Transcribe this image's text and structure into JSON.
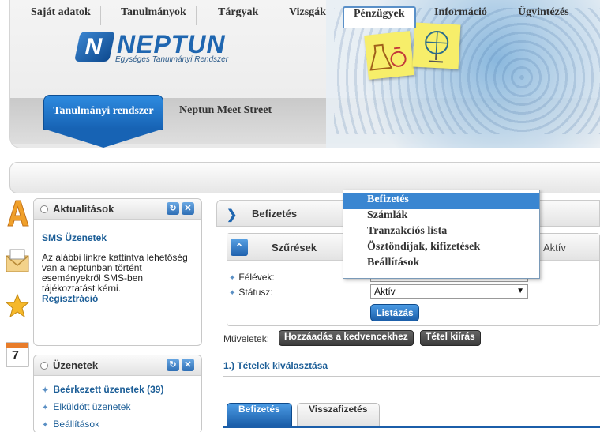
{
  "app": {
    "logo_title": "NEPTUN",
    "logo_subtitle": "Egységes Tanulmányi Rendszer",
    "system_tab": "Tanulmányi rendszer",
    "meet_street": "Neptun Meet Street"
  },
  "nav": {
    "items": [
      "Saját adatok",
      "Tanulmányok",
      "Tárgyak",
      "Vizsgák",
      "Pénzügyek",
      "Információ",
      "Ügyintézés"
    ],
    "active_index": 4
  },
  "dropdown": {
    "items": [
      "Befizetés",
      "Számlák",
      "Tranzakciós lista",
      "Ösztöndíjak, kifizetések",
      "Beállítások"
    ],
    "highlighted_index": 0
  },
  "side_icons": [
    "a-icon",
    "envelope-icon",
    "star-icon",
    "calendar-icon"
  ],
  "side_calendar_number": "7",
  "news_panel": {
    "title": "Aktualitások",
    "sms_title": "SMS Üzenetek",
    "sms_text": "Az alábbi linkre kattintva lehetőség van a neptunban történt eseményekről SMS-ben tájékoztatást kérni.",
    "sms_link": "Regisztráció"
  },
  "messages_panel": {
    "title": "Üzenetek",
    "items": [
      "Beérkezett üzenetek (39)",
      "Elküldött üzenetek",
      "Beállítások"
    ]
  },
  "main": {
    "title": "Befizetés",
    "filter": {
      "title": "Szűrések",
      "status_text": "Aktív",
      "semester_label": "Félévek:",
      "semester_value": "",
      "status_label": "Státusz:",
      "status_value": "Aktív",
      "list_button": "Listázás"
    },
    "operations_label": "Műveletek:",
    "add_favorites_button": "Hozzáadás a kedvencekhez",
    "print_button": "Tétel kiírás",
    "section_title": "1.) Tételek kiválasztása",
    "tabs": [
      "Befizetés",
      "Visszafizetés"
    ]
  },
  "colors": {
    "accent": "#1f66b0",
    "highlight": "#3a86d1",
    "dark_button": "#3b3b3b"
  }
}
